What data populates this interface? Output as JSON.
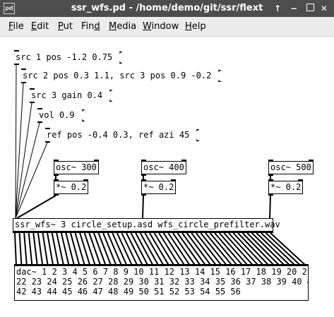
{
  "window": {
    "title": "ssr_wfs.pd  - /home/demo/git/ssr/flext",
    "app_icon": "pd",
    "buttons": [
      "↑",
      "−",
      "□",
      "✕"
    ]
  },
  "menu": {
    "items": [
      {
        "first": "F",
        "rest": "ile"
      },
      {
        "first": "E",
        "rest": "dit"
      },
      {
        "first": "P",
        "rest": "ut"
      },
      {
        "pre": "Fin",
        "first": "d",
        "rest": ""
      },
      {
        "first": "M",
        "rest": "edia"
      },
      {
        "first": "W",
        "rest": "indow"
      },
      {
        "first": "H",
        "rest": "elp"
      }
    ]
  },
  "patch": {
    "messages": [
      "src 1 pos -1.2 0.75",
      "src 2 pos 0.3 1.1, src 3 pos 0.9 -0.2",
      "src 3 gain 0.4",
      "vol 0.9",
      "ref pos -0.4 0.3, ref azi 45"
    ],
    "osc": [
      "osc~ 300",
      "osc~ 400",
      "osc~ 500"
    ],
    "mult": [
      "*~ 0.2",
      "*~ 0.2",
      "*~ 0.2"
    ],
    "ssr": "ssr_wfs~ 3 circle_setup.asd wfs_circle_prefilter.wav",
    "dac_lines": [
      "dac~ 1 2 3 4 5 6 7 8 9 10 11 12 13 14 15 16 17 18 19 20 21",
      "22 23 24 25 26 27 28 29 30 31 32 33 34 35 36 37 38 39 40 41",
      "42 43 44 45 46 47 48 49 50 51 52 53 54 55 56"
    ]
  }
}
